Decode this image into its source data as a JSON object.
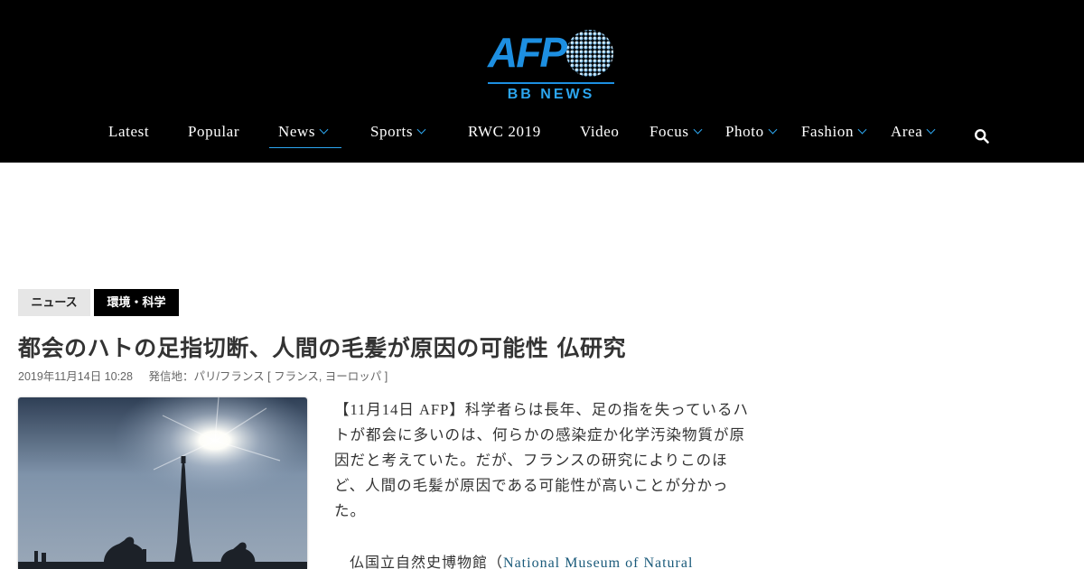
{
  "logo": {
    "brand": "AFP",
    "sub": "BB NEWS"
  },
  "nav": {
    "items": [
      {
        "label": "Latest",
        "dropdown": false
      },
      {
        "label": "Popular",
        "dropdown": false
      },
      {
        "label": "News",
        "dropdown": true,
        "active": true
      },
      {
        "label": "Sports",
        "dropdown": true
      },
      {
        "label": "RWC 2019",
        "dropdown": false
      },
      {
        "label": "Video",
        "dropdown": false
      },
      {
        "label": "Focus",
        "dropdown": true
      },
      {
        "label": "Photo",
        "dropdown": true
      },
      {
        "label": "Fashion",
        "dropdown": true
      },
      {
        "label": "Area",
        "dropdown": true
      }
    ],
    "search_icon": "search-icon"
  },
  "colors": {
    "accent": "#2ca6f0",
    "header_bg": "#000000",
    "tag_news_bg": "#e6e6e6",
    "tag_env_bg": "#000000"
  },
  "article": {
    "tags": [
      "ニュース",
      "環境・科学"
    ],
    "headline": "都会のハトの足指切断、人間の毛髪が原因の可能性 仏研究",
    "date": "2019年11月14日 10:28",
    "location": "発信地：パリ/フランス [ フランス, ヨーロッパ ]",
    "body_lines": [
      "【11月14日 AFP】科学者らは長年、足の指を失っているハ",
      "トが都会に多いのは、何らかの感染症か化学汚染物質が原",
      "因だと考えていた。だが、フランスの研究によりこのほ",
      "ど、人間の毛髪が原因である可能性が高いことが分かっ",
      "た。"
    ],
    "para2_prefix": "仏国立自然史博物館（",
    "para2_link": "National Museum of Natural"
  }
}
